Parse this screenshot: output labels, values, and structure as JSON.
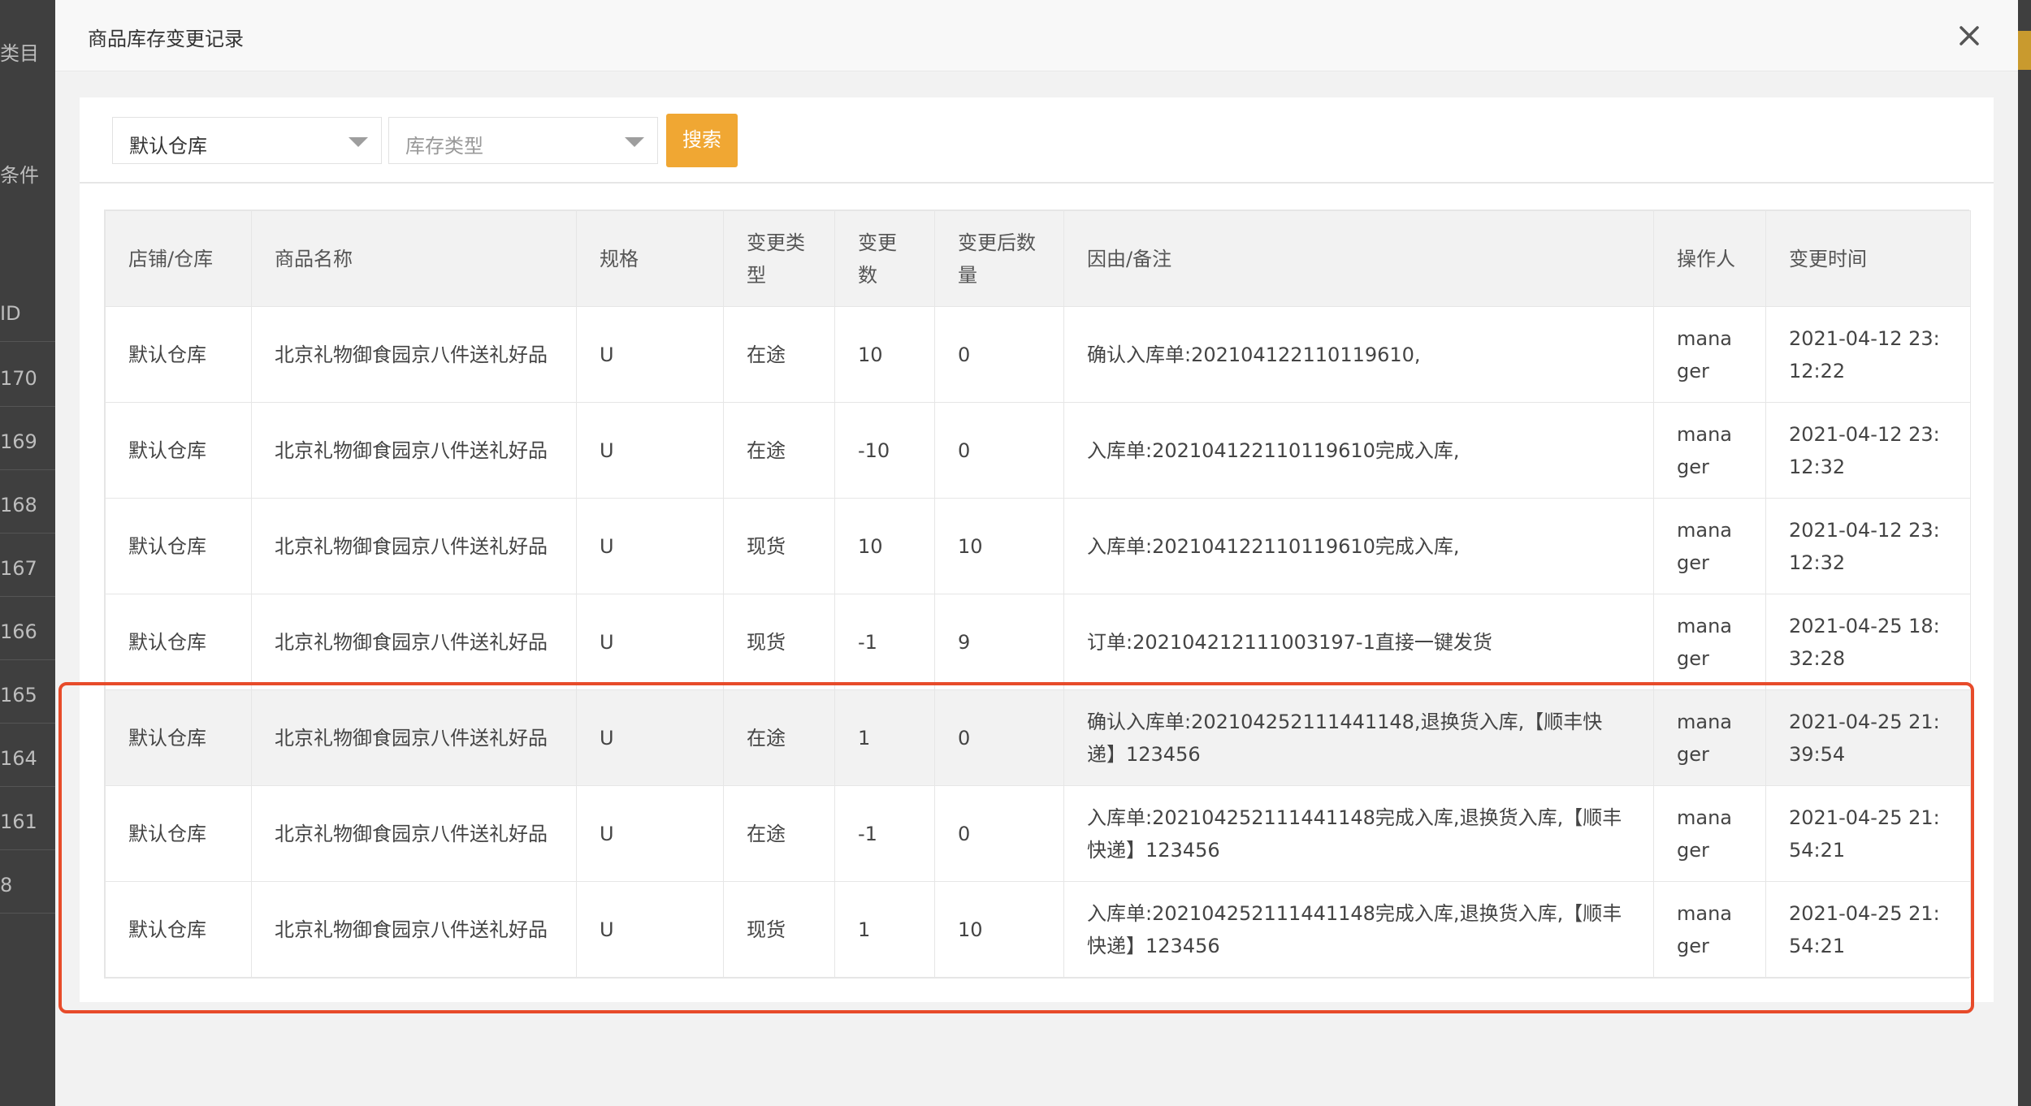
{
  "background": {
    "left_texts": [
      "类目",
      "条件",
      "ID",
      "170",
      "169",
      "168",
      "167",
      "166",
      "165",
      "164",
      "161",
      "8"
    ]
  },
  "modal": {
    "title": "商品库存变更记录"
  },
  "filters": {
    "warehouse_value": "默认仓库",
    "type_placeholder": "库存类型",
    "search_label": "搜索"
  },
  "table": {
    "headers": {
      "store": "店铺/仓库",
      "product": "商品名称",
      "spec": "规格",
      "change_type": "变更类型",
      "change_qty": "变更数",
      "after_qty": "变更后数量",
      "reason": "因由/备注",
      "operator": "操作人",
      "time": "变更时间"
    },
    "rows": [
      {
        "store": "默认仓库",
        "product": "北京礼物御食园京八件送礼好品",
        "spec": "U",
        "change_type": "在途",
        "change_qty": "10",
        "after_qty": "0",
        "reason": "确认入库单:202104122110119610,",
        "operator": "manager",
        "time": "2021-04-12 23:12:22"
      },
      {
        "store": "默认仓库",
        "product": "北京礼物御食园京八件送礼好品",
        "spec": "U",
        "change_type": "在途",
        "change_qty": "-10",
        "after_qty": "0",
        "reason": "入库单:202104122110119610完成入库,",
        "operator": "manager",
        "time": "2021-04-12 23:12:32"
      },
      {
        "store": "默认仓库",
        "product": "北京礼物御食园京八件送礼好品",
        "spec": "U",
        "change_type": "现货",
        "change_qty": "10",
        "after_qty": "10",
        "reason": "入库单:202104122110119610完成入库,",
        "operator": "manager",
        "time": "2021-04-12 23:12:32"
      },
      {
        "store": "默认仓库",
        "product": "北京礼物御食园京八件送礼好品",
        "spec": "U",
        "change_type": "现货",
        "change_qty": "-1",
        "after_qty": "9",
        "reason": "订单:202104212111003197-1直接一键发货",
        "operator": "manager",
        "time": "2021-04-25 18:32:28"
      },
      {
        "store": "默认仓库",
        "product": "北京礼物御食园京八件送礼好品",
        "spec": "U",
        "change_type": "在途",
        "change_qty": "1",
        "after_qty": "0",
        "reason": "确认入库单:202104252111441148,退换货入库,【顺丰快递】123456",
        "operator": "manager",
        "time": "2021-04-25 21:39:54"
      },
      {
        "store": "默认仓库",
        "product": "北京礼物御食园京八件送礼好品",
        "spec": "U",
        "change_type": "在途",
        "change_qty": "-1",
        "after_qty": "0",
        "reason": "入库单:202104252111441148完成入库,退换货入库,【顺丰快递】123456",
        "operator": "manager",
        "time": "2021-04-25 21:54:21"
      },
      {
        "store": "默认仓库",
        "product": "北京礼物御食园京八件送礼好品",
        "spec": "U",
        "change_type": "现货",
        "change_qty": "1",
        "after_qty": "10",
        "reason": "入库单:202104252111441148完成入库,退换货入库,【顺丰快递】123456",
        "operator": "manager",
        "time": "2021-04-25 21:54:21"
      }
    ]
  },
  "colors": {
    "accent": "#f0a733",
    "highlight_border": "#e74b2a"
  }
}
